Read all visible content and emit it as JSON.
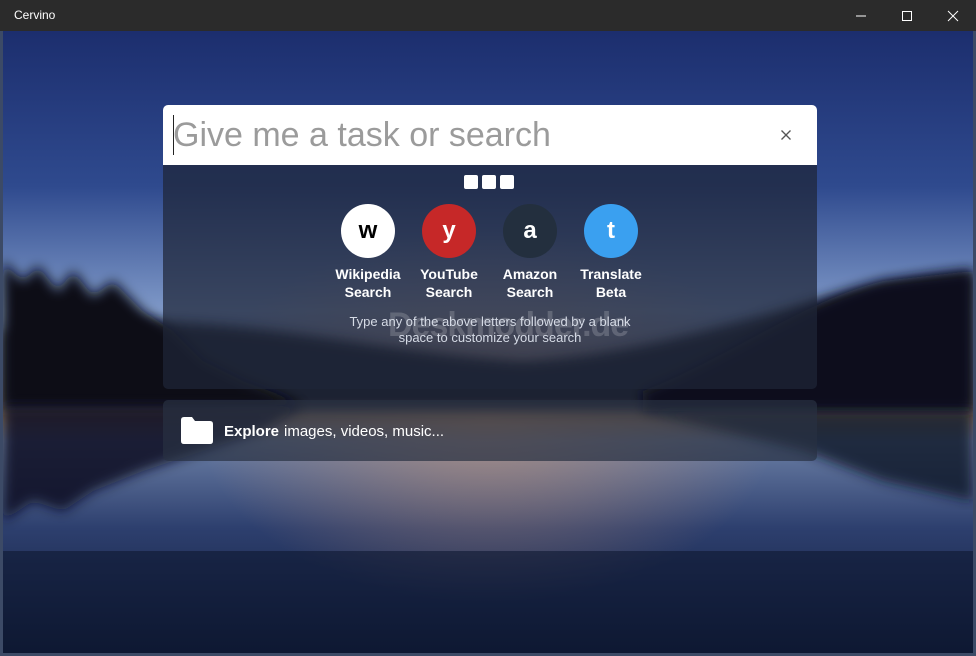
{
  "window": {
    "title": "Cervino",
    "controls": [
      "minimize-icon",
      "maximize-icon",
      "close-icon"
    ]
  },
  "search": {
    "placeholder": "Give me a task or search",
    "value": "",
    "clear_icon": "close-icon"
  },
  "pager": {
    "count": 3
  },
  "shortcuts": [
    {
      "letter": "w",
      "label_line1": "Wikipedia",
      "label_line2": "Search",
      "bg": "#ffffff",
      "fg": "#000000"
    },
    {
      "letter": "y",
      "label_line1": "YouTube",
      "label_line2": "Search",
      "bg": "#c62828",
      "fg": "#ffffff"
    },
    {
      "letter": "a",
      "label_line1": "Amazon",
      "label_line2": "Search",
      "bg": "#232f3e",
      "fg": "#ffffff"
    },
    {
      "letter": "t",
      "label_line1": "Translate",
      "label_line2": "Beta",
      "bg": "#3aa0f0",
      "fg": "#ffffff"
    }
  ],
  "hint": {
    "line1": "Type any of the above letters followed by a blank",
    "line2": "space to customize your search"
  },
  "watermark": "Deskmodder.de",
  "explore": {
    "icon": "folder-icon",
    "title": "Explore",
    "subtitle": "images, videos, music..."
  },
  "colors": {
    "titlebar": "#2b2b2b",
    "panel": "rgba(30,38,56,0.72)"
  }
}
